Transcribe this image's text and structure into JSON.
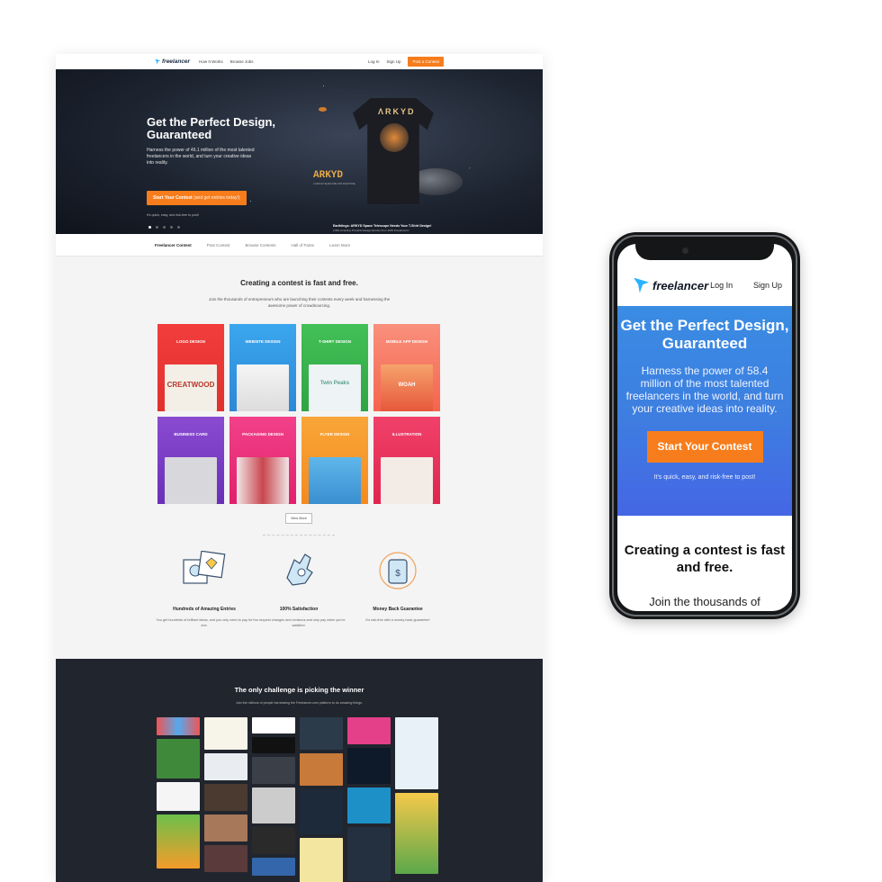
{
  "desktop": {
    "nav": {
      "logo": "freelancer",
      "links": [
        "How It Works",
        "Browse Jobs"
      ],
      "login": "Log In",
      "signup": "Sign Up",
      "post_contest": "Post a Contest"
    },
    "hero": {
      "title": "Get the Perfect Design, Guaranteed",
      "subtitle": "Harness the power of 46.1 million of the most talented freelancers in the world, and turn your creative ideas into reality.",
      "cta_main": "Start Your Contest",
      "cta_extra": "(and get entries today!)",
      "quick": "It's quick, easy, and risk-free to post!",
      "shirt_text": "ARKYD",
      "shirt_sub": "A SPACE TELESCOPE FOR EVERYONE",
      "caption_title": "Earthlings: ARKYD Space Telescope Needs Your T-Shirt Design!",
      "caption_sub": "2,991 Amazing Threshirt Design Entries from 1169 Freelancers!"
    },
    "tabs": [
      "Freelancer Contest",
      "Post Contest",
      "Browse Contests",
      "Hall of Fame",
      "Learn More"
    ],
    "section": {
      "title": "Creating a contest is fast and free.",
      "subtitle": "Join the thousands of entrepreneurs who are launching their contests every week and harnessing the awesome power of crowdsourcing."
    },
    "categories": [
      {
        "label": "LOGO DESIGN",
        "color": "#f23d3d",
        "sample": "CREATWOOD"
      },
      {
        "label": "WEBSITE DESIGN",
        "color": "#3aa6ee",
        "sample": ""
      },
      {
        "label": "T-SHIRT DESIGN",
        "color": "#39b54a",
        "sample": "Twin Peaks"
      },
      {
        "label": "MOBILE APP DESIGN",
        "color": "#f56d5a",
        "sample": "WOAH"
      },
      {
        "label": "BUSINESS CARD",
        "color": "#7b3fc4",
        "sample": ""
      },
      {
        "label": "PACKAGING DESIGN",
        "color": "#ee2e7a",
        "sample": ""
      },
      {
        "label": "FLYER DESIGN",
        "color": "#f7941d",
        "sample": ""
      },
      {
        "label": "ILLUSTRATION",
        "color": "#ec2c5b",
        "sample": ""
      }
    ],
    "view_more": "View More",
    "features": [
      {
        "title": "Hundreds of Amazing Entries",
        "text": "You get hundreds of brilliant ideas, and you only need to pay for one."
      },
      {
        "title": "100% Satisfaction",
        "text": "You request changes and revisions and only pay when you're satisfied."
      },
      {
        "title": "Money Back Guarantee",
        "text": "It's risk-free with a money back guarantee!"
      }
    ],
    "winner": {
      "title": "The only challenge is picking the winner",
      "subtitle": "Join the millions of people harnessing the Freelancer.com platform to do amazing things."
    }
  },
  "mobile": {
    "nav": {
      "logo": "freelancer",
      "login": "Log In",
      "signup": "Sign Up"
    },
    "hero": {
      "title": "Get the Perfect Design, Guaranteed",
      "subtitle": "Harness the power of 58.4 million of the most talented freelancers in the world, and turn your creative ideas into reality.",
      "cta": "Start Your Contest",
      "quick": "It's quick, easy, and risk-free to post!"
    },
    "section": {
      "title": "Creating a contest is fast and free.",
      "subtitle": "Join the thousands of entrepreneurs who are"
    }
  },
  "colors": {
    "accent_orange": "#f77d1c",
    "brand_blue": "#29b2fe",
    "dark_section": "#21252e"
  }
}
